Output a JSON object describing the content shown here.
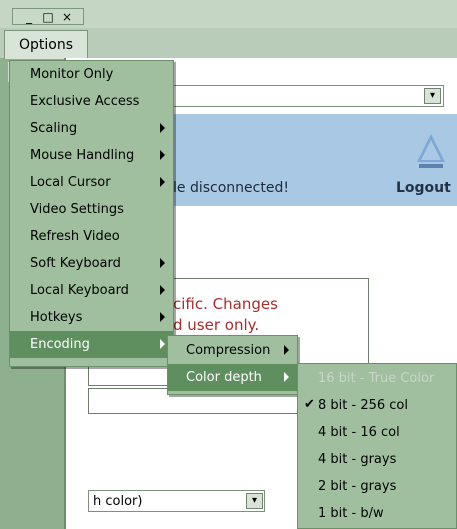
{
  "window": {
    "controls": {
      "minimize": "_",
      "maximize": "□",
      "close": "×"
    }
  },
  "options_tab": "Options",
  "status": {
    "message": "le disconnected!",
    "logout": "Logout"
  },
  "notice": {
    "line1": "cific. Changes",
    "line2": "d user only."
  },
  "color_select": {
    "value": "h color)"
  },
  "menu": {
    "items": [
      "Monitor Only",
      "Exclusive Access",
      "Scaling",
      "Mouse Handling",
      "Local Cursor",
      "Video Settings",
      "Refresh Video",
      "Soft Keyboard",
      "Local Keyboard",
      "Hotkeys",
      "Encoding"
    ]
  },
  "encoding_menu": {
    "items": [
      "Compression",
      "Color depth"
    ]
  },
  "color_depth_menu": {
    "items": [
      "16 bit - True Color",
      "8 bit - 256 col",
      "4 bit - 16 col",
      "4 bit - grays",
      "2 bit - grays",
      "1 bit - b/w"
    ]
  }
}
